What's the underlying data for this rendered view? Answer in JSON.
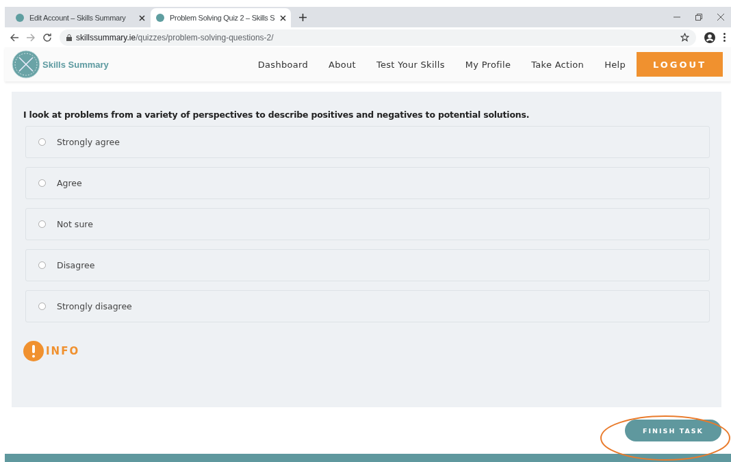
{
  "browser": {
    "tabs": [
      {
        "title": "Edit Account – Skills Summary",
        "selected": false
      },
      {
        "title": "Problem Solving Quiz 2 – Skills S",
        "selected": true
      }
    ],
    "url": {
      "host": "skillssummary.ie",
      "path": "/quizzes/problem-solving-questions-2/"
    }
  },
  "site": {
    "logo_text": "Skills Summary",
    "nav": [
      "Dashboard",
      "About",
      "Test Your Skills",
      "My Profile",
      "Take Action",
      "Help"
    ],
    "logout": "LOGOUT"
  },
  "quiz": {
    "question": "I look at problems from a variety of perspectives to describe positives and negatives to potential solutions.",
    "options": [
      {
        "label": "Strongly agree",
        "selected": false
      },
      {
        "label": "Agree",
        "selected": false
      },
      {
        "label": "Not sure",
        "selected": false
      },
      {
        "label": "Disagree",
        "selected": false
      },
      {
        "label": "Strongly disagree",
        "selected": false
      }
    ],
    "info": "INFO"
  },
  "finish_button": "FINISH TASK"
}
